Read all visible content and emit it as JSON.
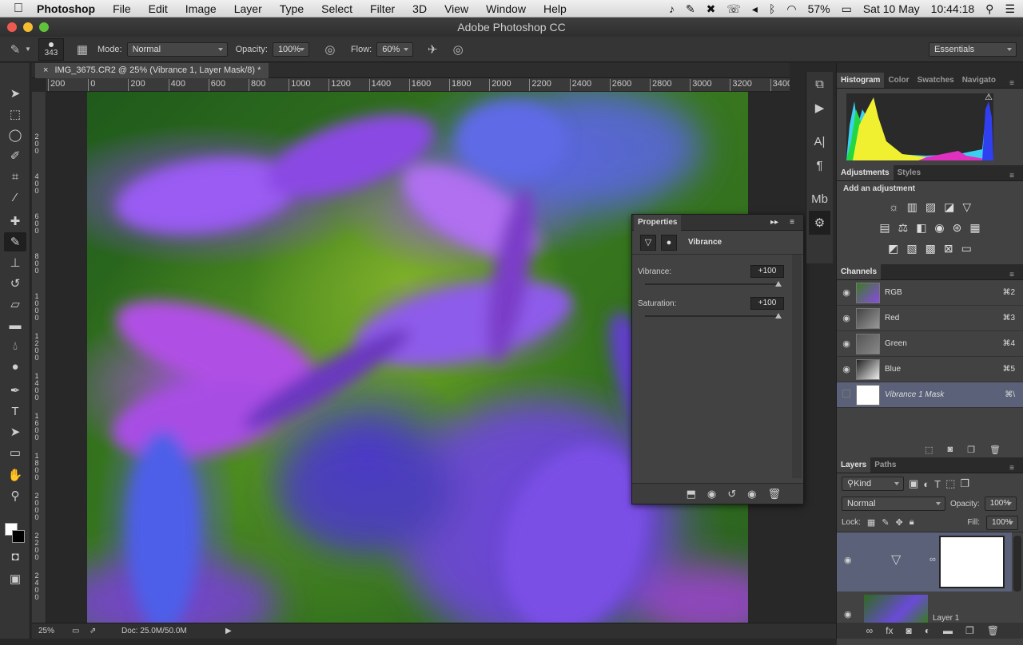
{
  "menubar": {
    "app": "Photoshop",
    "items": [
      "File",
      "Edit",
      "Image",
      "Layer",
      "Type",
      "Select",
      "Filter",
      "3D",
      "View",
      "Window",
      "Help"
    ],
    "battery": "57%",
    "date": "Sat 10 May",
    "time": "10:44:18"
  },
  "window": {
    "title": "Adobe Photoshop CC"
  },
  "options": {
    "brush_size": "343",
    "mode_label": "Mode:",
    "mode_value": "Normal",
    "opacity_label": "Opacity:",
    "opacity_value": "100%",
    "flow_label": "Flow:",
    "flow_value": "60%",
    "workspace": "Essentials"
  },
  "document": {
    "tab_title": "IMG_3675.CR2 @ 25% (Vibrance 1, Layer Mask/8) *",
    "ruler_h": [
      "200",
      "0",
      "200",
      "400",
      "600",
      "800",
      "1000",
      "1200",
      "1400",
      "1600",
      "1800",
      "2000",
      "2200",
      "2400",
      "2600",
      "2800",
      "3000",
      "3200",
      "3400"
    ],
    "ruler_v": [
      "2\n0\n0",
      "4\n0\n0",
      "6\n0\n0",
      "8\n0\n0",
      "1\n0\n0\n0",
      "1\n2\n0\n0",
      "1\n4\n0\n0",
      "1\n6\n0\n0",
      "1\n8\n0\n0",
      "2\n0\n0\n0",
      "2\n2\n0\n0",
      "2\n4\n0\n0"
    ]
  },
  "status": {
    "zoom": "25%",
    "doc": "Doc: 25.0M/50.0M"
  },
  "properties": {
    "title": "Properties",
    "adjustment": "Vibrance",
    "vibrance_label": "Vibrance:",
    "vibrance_value": "+100",
    "saturation_label": "Saturation:",
    "saturation_value": "+100"
  },
  "histogram_tabs": [
    "Histogram",
    "Color",
    "Swatches",
    "Navigato"
  ],
  "adjustments_tabs": [
    "Adjustments",
    "Styles"
  ],
  "adjustments_heading": "Add an adjustment",
  "channels": {
    "tab": "Channels",
    "rows": [
      {
        "name": "RGB",
        "shortcut": "⌘2"
      },
      {
        "name": "Red",
        "shortcut": "⌘3"
      },
      {
        "name": "Green",
        "shortcut": "⌘4"
      },
      {
        "name": "Blue",
        "shortcut": "⌘5"
      },
      {
        "name": "Vibrance 1 Mask",
        "shortcut": "⌘\\"
      }
    ]
  },
  "layers": {
    "tabs": [
      "Layers",
      "Paths"
    ],
    "filter": "Kind",
    "blend": "Normal",
    "opacity_label": "Opacity:",
    "opacity_value": "100%",
    "lock_label": "Lock:",
    "fill_label": "Fill:",
    "fill_value": "100%",
    "layer_1_name": "Layer 1"
  },
  "colors": {
    "panel": "#424242",
    "dark": "#353535",
    "selected_row": "#5a6178",
    "accent_purple": "#8d4ae4",
    "accent_green": "#5f9c22"
  }
}
